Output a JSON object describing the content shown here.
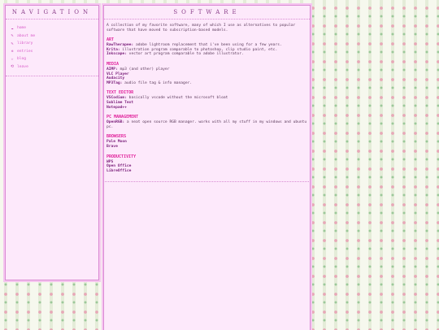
{
  "nav": {
    "title": "NAVIGATION",
    "items": [
      {
        "icon": "cloud-icon",
        "glyph": "☁",
        "label": "home"
      },
      {
        "icon": "pencil-icon",
        "glyph": "✎",
        "label": "about me"
      },
      {
        "icon": "bookmark-icon",
        "glyph": "✎",
        "label": "library"
      },
      {
        "icon": "sparkle-icon",
        "glyph": "✲",
        "label": "entries"
      },
      {
        "icon": "star-icon",
        "glyph": "☆",
        "label": "blog"
      },
      {
        "icon": "return-icon",
        "glyph": "⟲",
        "label": "leave"
      }
    ]
  },
  "main": {
    "title": "SOFTWARE",
    "intro": "A collection of my favorite software, many of which I use as alternatives to popular software that have moved to subscription-based models.",
    "sections": [
      {
        "heading": "ART",
        "entries": [
          {
            "name": "RawTherapee:",
            "desc": " adobe lightroom replacement that i've been using for a few years."
          },
          {
            "name": "Krita:",
            "desc": " illustration program comparable to photoshop, clip studio paint, etc."
          },
          {
            "name": "Inkscape:",
            "desc": " vector art program comparable to adobe illustrator."
          }
        ]
      },
      {
        "heading": "MEDIA",
        "entries": [
          {
            "name": "AIMP:",
            "desc": " mp3 (and other) player"
          },
          {
            "name": "VLC Player",
            "desc": ""
          },
          {
            "name": "Audacity",
            "desc": ""
          },
          {
            "name": "MP3Tag:",
            "desc": " audio file tag & info manager."
          }
        ]
      },
      {
        "heading": "TEXT EDITOR",
        "entries": [
          {
            "name": "VSCodium:",
            "desc": " basically vscode without the microsoft bloat"
          },
          {
            "name": "Sublime Text",
            "desc": ""
          },
          {
            "name": "Notepad++",
            "desc": ""
          }
        ]
      },
      {
        "heading": "PC MANAGEMENT",
        "entries": [
          {
            "name": "OpenRGB:",
            "desc": " a neat open source RGB manager. works with all my stuff in my windows and ubuntu pc."
          }
        ]
      },
      {
        "heading": "BROWSERS",
        "entries": [
          {
            "name": "Pale Moon",
            "desc": ""
          },
          {
            "name": "Brave",
            "desc": ""
          }
        ]
      },
      {
        "heading": "PRODUCTIVITY",
        "entries": [
          {
            "name": "WPS",
            "desc": ""
          },
          {
            "name": "Open Office",
            "desc": ""
          },
          {
            "name": "LibreOffice",
            "desc": ""
          }
        ]
      }
    ]
  }
}
